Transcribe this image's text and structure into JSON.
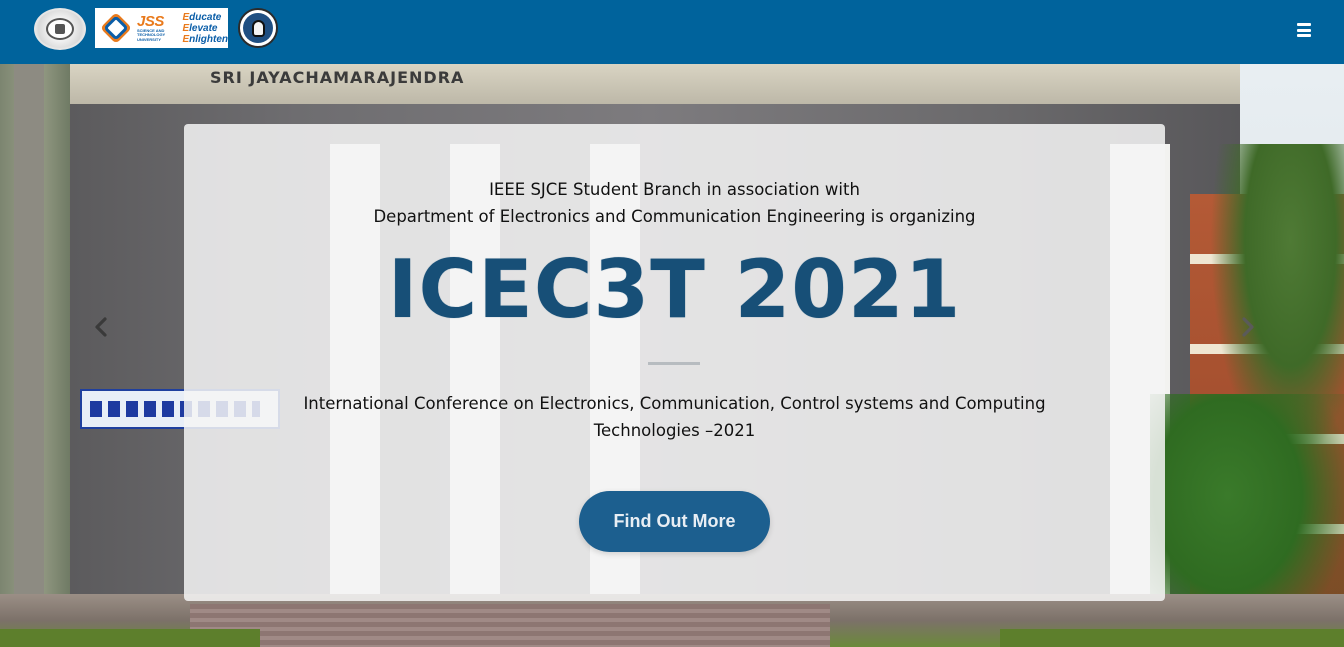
{
  "navbar": {
    "background_color": "#00639c",
    "logos": [
      {
        "name": "university-seal-logo"
      },
      {
        "name": "jss-stu-logo",
        "brand": "JSS",
        "subtitle_lines": [
          "SCIENCE AND",
          "TECHNOLOGY",
          "UNIVERSITY"
        ],
        "motto": [
          "Educate",
          "Elevate",
          "Enlighten"
        ]
      },
      {
        "name": "ieee-bulb-logo"
      }
    ],
    "menu_icon": "hamburger-menu-icon"
  },
  "hero": {
    "building_sign": "SRI JAYACHAMARAJENDRA",
    "intro_line_1": "IEEE SJCE Student Branch in association with",
    "intro_line_2": "Department of Electronics and Communication Engineering is organizing",
    "headline": "ICEC3T 2021",
    "subtitle": "International Conference on Electronics, Communication, Control systems and Computing Technologies –2021",
    "cta_label": "Find Out More",
    "prev_icon": "chevron-left-icon",
    "next_icon": "chevron-right-icon",
    "accent_color": "#1c5f8f",
    "headline_color": "#174f77"
  }
}
